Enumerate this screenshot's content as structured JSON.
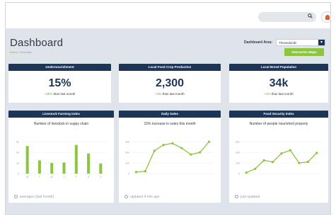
{
  "header": {
    "title": "Dashboard",
    "breadcrumb": {
      "home": "Home",
      "current": "Overview"
    },
    "area_label": "Dashboard Area:",
    "area_value": "Thessaloniki",
    "map_button": "Interactive Maps"
  },
  "colors": {
    "navy": "#1d3557",
    "green": "#8cc63e",
    "panel_bg": "#dfe4ea"
  },
  "icons": {
    "search": "search-icon",
    "user": "user-avatar-icon",
    "dropdown": "chevron-down-icon",
    "clock": "clock-icon"
  },
  "kpis": [
    {
      "title": "Undernourishment",
      "value": "15%",
      "change": "+40%",
      "suffix": " than last month"
    },
    {
      "title": "Local Food Crop Production",
      "value": "2,300",
      "change": "+3%",
      "suffix": " than last month"
    },
    {
      "title": "Local Breed Population",
      "value": "34k",
      "change": "+1%",
      "suffix": " than last month"
    }
  ],
  "charts": [
    {
      "title": "Livestock Farming Index",
      "subtitle": "Number of livestock in suppy chain",
      "footer": "averages (last month)"
    },
    {
      "title": "Daily Sales",
      "subtitle": "15% increase in sales this month",
      "footer": "updated 4 min ago"
    },
    {
      "title": "Food Security Index",
      "subtitle": "Number of people nourished properly",
      "footer": "just updated"
    }
  ],
  "chart_data": [
    {
      "type": "bar",
      "title": "Number of livestock in suppy chain",
      "categories": [
        "M",
        "T",
        "W",
        "T",
        "F",
        "S",
        "S"
      ],
      "yticks": [
        "0",
        "20",
        "40",
        "60"
      ],
      "ylim": [
        0,
        80
      ],
      "values": [
        52,
        25,
        20,
        21,
        54,
        38,
        19
      ],
      "grid": true
    },
    {
      "type": "line",
      "title": "15% increase in sales this month",
      "categories": [
        "",
        "",
        "",
        "",
        "",
        "",
        "",
        "",
        ""
      ],
      "yticks": [
        "0",
        "200",
        "400",
        "600"
      ],
      "ylim": [
        0,
        800
      ],
      "values": [
        30,
        45,
        430,
        540,
        570,
        480,
        360,
        400,
        600
      ],
      "grid": true
    },
    {
      "type": "line",
      "title": "Number of people nourished properly",
      "categories": [
        "",
        "",
        "",
        "",
        "",
        "",
        "",
        "",
        ""
      ],
      "yticks": [
        "0",
        "200",
        "400",
        "600"
      ],
      "ylim": [
        0,
        800
      ],
      "values": [
        20,
        90,
        250,
        220,
        380,
        440,
        200,
        220,
        390
      ],
      "grid": true
    }
  ]
}
